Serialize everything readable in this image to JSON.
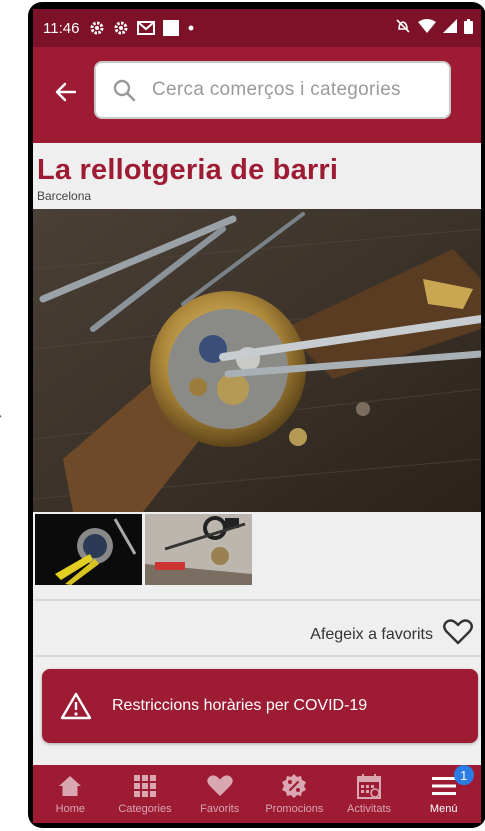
{
  "statusbar": {
    "time": "11:46"
  },
  "search": {
    "placeholder": "Cerca comerços i categories"
  },
  "store": {
    "name": "La rellotgeria de barri",
    "city": "Barcelona"
  },
  "favorites": {
    "label": "Afegeix a favorits"
  },
  "covid": {
    "label": "Restriccions horàries per COVID-19"
  },
  "nav": {
    "items": [
      {
        "label": "Home",
        "icon": "home-icon"
      },
      {
        "label": "Categories",
        "icon": "grid-icon"
      },
      {
        "label": "Favorits",
        "icon": "heart-icon"
      },
      {
        "label": "Promocions",
        "icon": "percent-badge-icon"
      },
      {
        "label": "Activitats",
        "icon": "calendar-icon"
      },
      {
        "label": "Menú",
        "icon": "menu-icon"
      }
    ],
    "menu_badge": "1"
  },
  "colors": {
    "brand": "#9e1b34",
    "statusbar": "#7d1127",
    "badge": "#2a7be4"
  }
}
